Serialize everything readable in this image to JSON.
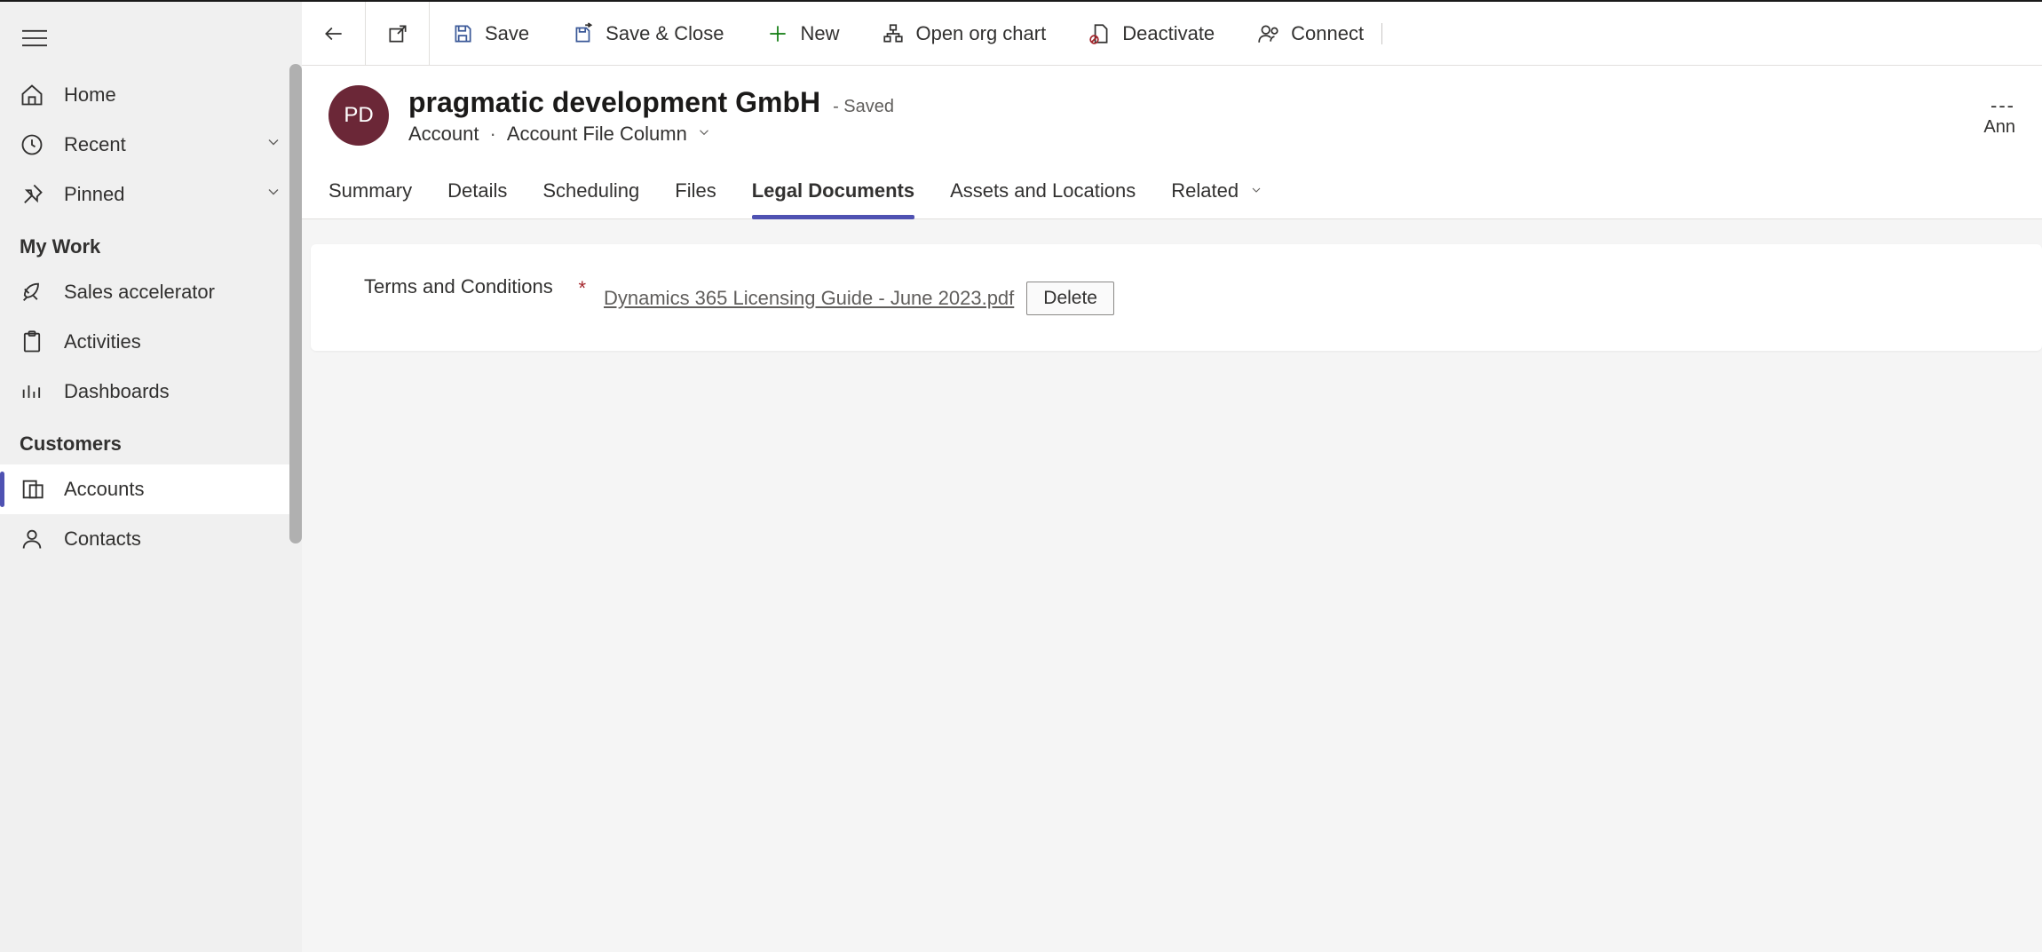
{
  "sidebar": {
    "home": "Home",
    "recent": "Recent",
    "pinned": "Pinned",
    "sections": {
      "mywork": {
        "title": "My Work",
        "items": [
          "Sales accelerator",
          "Activities",
          "Dashboards"
        ]
      },
      "customers": {
        "title": "Customers",
        "items": [
          "Accounts",
          "Contacts"
        ]
      }
    }
  },
  "cmdbar": {
    "save": "Save",
    "save_close": "Save & Close",
    "new": "New",
    "open_org": "Open org chart",
    "deactivate": "Deactivate",
    "connect": "Connect"
  },
  "header": {
    "avatar_initials": "PD",
    "title": "pragmatic development GmbH",
    "saved": "- Saved",
    "entity": "Account",
    "form": "Account File Column",
    "right_dash": "---",
    "right_sub": "Ann"
  },
  "tabs": [
    "Summary",
    "Details",
    "Scheduling",
    "Files",
    "Legal Documents",
    "Assets and Locations",
    "Related"
  ],
  "active_tab_index": 4,
  "content": {
    "field_label": "Terms and Conditions",
    "file_name": "Dynamics 365 Licensing Guide - June 2023.pdf",
    "delete_label": "Delete"
  }
}
